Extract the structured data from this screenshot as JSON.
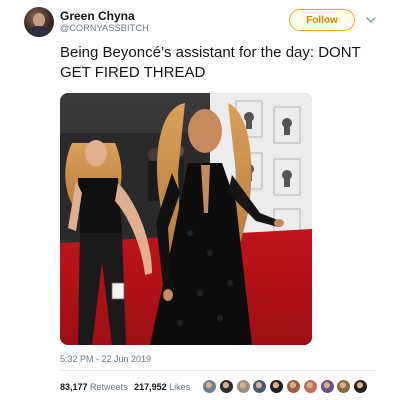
{
  "author": {
    "display_name": "Green Chyna",
    "handle": "@CORNYASSBITCH",
    "avatar_icon": "profile-photo"
  },
  "header": {
    "follow_label": "Follow",
    "menu_icon": "chevron-down-icon",
    "accent": "#f5a623"
  },
  "tweet": {
    "text": "Being Beyoncé’s assistant for the day: DONT GET FIRED THREAD",
    "image": "photo of an assistant holding the hem of a black dress on a red carpet",
    "timestamp": "5:32 PM - 22 Jun 2019"
  },
  "stats": {
    "retweets_count": "83,177",
    "retweets_label": "Retweets",
    "likes_count": "217,952",
    "likes_label": "Likes"
  },
  "likers": [
    {
      "name": "liker-avatar-1",
      "color": "#6b7f9a"
    },
    {
      "name": "liker-avatar-2",
      "color": "#2d2d2d"
    },
    {
      "name": "liker-avatar-3",
      "color": "#9a8f85"
    },
    {
      "name": "liker-avatar-4",
      "color": "#3f5b7a"
    },
    {
      "name": "liker-avatar-5",
      "color": "#1e1e1e"
    },
    {
      "name": "liker-avatar-6",
      "color": "#a05a3c"
    },
    {
      "name": "liker-avatar-7",
      "color": "#c86a5a"
    },
    {
      "name": "liker-avatar-8",
      "color": "#6a4f8a"
    },
    {
      "name": "liker-avatar-9",
      "color": "#8a6a3a"
    },
    {
      "name": "liker-avatar-10",
      "color": "#222222"
    }
  ]
}
